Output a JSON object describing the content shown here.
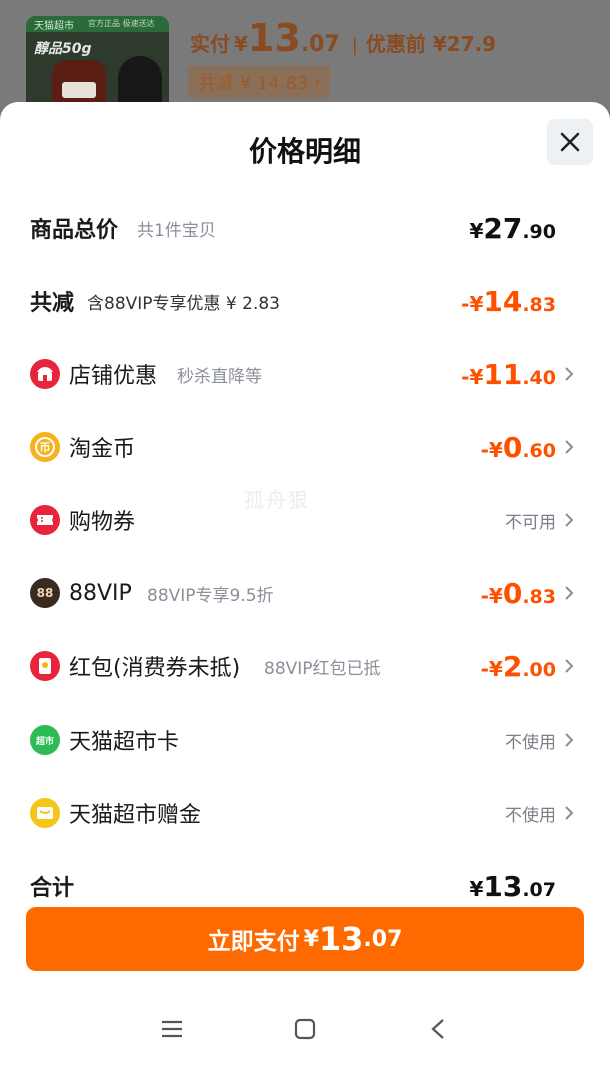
{
  "product_summary": {
    "thumb_tag": "天猫超市",
    "thumb_sub": "官方正品 极速送达",
    "thumb_label": "醇品50g",
    "actual_pay_label": "实付",
    "actual_pay_yen": "¥",
    "actual_pay_int": "13",
    "actual_pay_dec": ".07",
    "separator": "|",
    "before_discount": "优惠前 ¥27.9",
    "saved_chip": "共减 ¥ 14.83",
    "saved_chevron": "›"
  },
  "sheet": {
    "title": "价格明细",
    "close_icon": "close-icon"
  },
  "rows": [
    {
      "label": "商品总价",
      "sub": "共1件宝贝",
      "sign": "",
      "yen": "¥",
      "int": "27",
      "dec": ".90",
      "color": "#111111"
    },
    {
      "label": "共减",
      "sub": "含88VIP专享优惠 ¥ 2.83",
      "sign": "-",
      "yen": "¥",
      "int": "14",
      "dec": ".83",
      "color": "#ff5000"
    },
    {
      "label": "店铺优惠",
      "sub": "秒杀直降等",
      "icon": "shop-icon",
      "sign": "-",
      "yen": "¥",
      "int": "11",
      "dec": ".40",
      "color": "#ff5000"
    },
    {
      "label": "淘金币",
      "sub": "",
      "icon": "coin-icon",
      "sign": "-",
      "yen": "¥",
      "int": "0",
      "dec": ".60",
      "color": "#ff5000"
    },
    {
      "label": "购物券",
      "sub": "",
      "icon": "coupon-icon",
      "status": "不可用"
    },
    {
      "label": "88VIP",
      "sub": "88VIP专享9.5折",
      "icon": "vip88-icon",
      "sign": "-",
      "yen": "¥",
      "int": "0",
      "dec": ".83",
      "color": "#ff5000"
    },
    {
      "label": "红包(消费券未抵)",
      "sub": "88VIP红包已抵",
      "icon": "red-packet-icon",
      "sign": "-",
      "yen": "¥",
      "int": "2",
      "dec": ".00",
      "color": "#ff5000"
    },
    {
      "label": "天猫超市卡",
      "sub": "",
      "icon": "tmall-card-icon",
      "status": "不使用"
    },
    {
      "label": "天猫超市赠金",
      "sub": "",
      "icon": "gift-money-icon",
      "status": "不使用"
    }
  ],
  "icon_texts": {
    "coin": "币",
    "vip": "88",
    "card": "超市"
  },
  "total": {
    "label": "合计",
    "yen": "¥",
    "int": "13",
    "dec": ".07"
  },
  "watermark": "孤舟狠",
  "pay_button": {
    "label": "立即支付",
    "yen": "¥",
    "int": "13",
    "dec": ".07"
  },
  "colors": {
    "accent": "#ff6a00",
    "discount": "#ff5000",
    "icon_red": "#e8233c",
    "icon_gold": "#f5b21b",
    "icon_dark": "#3a2a22",
    "icon_green": "#2dbb55"
  },
  "navbar": {
    "menu_icon": "menu-icon",
    "home_icon": "home-icon",
    "back_icon": "back-icon"
  }
}
